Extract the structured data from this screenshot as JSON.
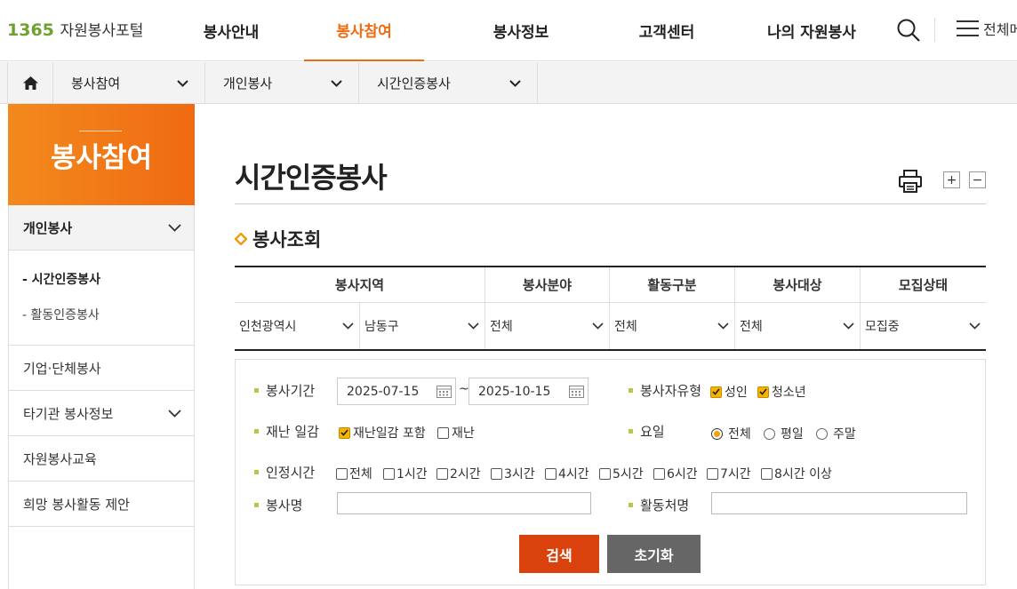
{
  "header": {
    "logo_number": "1365",
    "logo_text": "자원봉사포털",
    "nav": [
      "봉사안내",
      "봉사참여",
      "봉사정보",
      "고객센터",
      "나의 자원봉사"
    ],
    "active_nav": "봉사참여",
    "all_menu_label": "전체메뉴",
    "accent_color": "#f26b11"
  },
  "breadcrumb": [
    "봉사참여",
    "개인봉사",
    "시간인증봉사"
  ],
  "sidebar": {
    "title": "봉사참여",
    "items": [
      {
        "label": "개인봉사",
        "expanded": true,
        "children": [
          "- 시간인증봉사",
          "- 활동인증봉사"
        ]
      },
      {
        "label": "기업·단체봉사"
      },
      {
        "label": "타기관 봉사정보",
        "has_arrow": true
      },
      {
        "label": "자원봉사교육"
      },
      {
        "label": "희망 봉사활동 제안"
      }
    ]
  },
  "page": {
    "title": "시간인증봉사",
    "section_title": "봉사조회",
    "zoom_in": "+",
    "zoom_out": "−"
  },
  "filter": {
    "headers": [
      "봉사지역",
      "봉사분야",
      "활동구분",
      "봉사대상",
      "모집상태"
    ],
    "values": [
      "인천광역시",
      "남동구",
      "전체",
      "전체",
      "전체",
      "모집중"
    ]
  },
  "search": {
    "period_label": "봉사기간",
    "date_from": "2025-07-15",
    "date_sep": "~",
    "date_to": "2025-10-15",
    "type_label": "봉사자유형",
    "type_options": [
      {
        "label": "성인",
        "checked": true
      },
      {
        "label": "청소년",
        "checked": true
      }
    ],
    "disaster_label": "재난 일감",
    "disaster_options": [
      {
        "label": "재난일감 포함",
        "checked": true
      },
      {
        "label": "재난",
        "checked": false
      }
    ],
    "day_label": "요일",
    "day_options": [
      {
        "label": "전체",
        "checked": true
      },
      {
        "label": "평일",
        "checked": false
      },
      {
        "label": "주말",
        "checked": false
      }
    ],
    "hours_label": "인정시간",
    "hours_options": [
      "전체",
      "1시간",
      "2시간",
      "3시간",
      "4시간",
      "5시간",
      "6시간",
      "7시간",
      "8시간 이상"
    ],
    "name_label": "봉사명",
    "place_label": "활동처명",
    "search_button": "검색",
    "reset_button": "초기화",
    "search_color": "#d9420c",
    "reset_color": "#666666"
  }
}
